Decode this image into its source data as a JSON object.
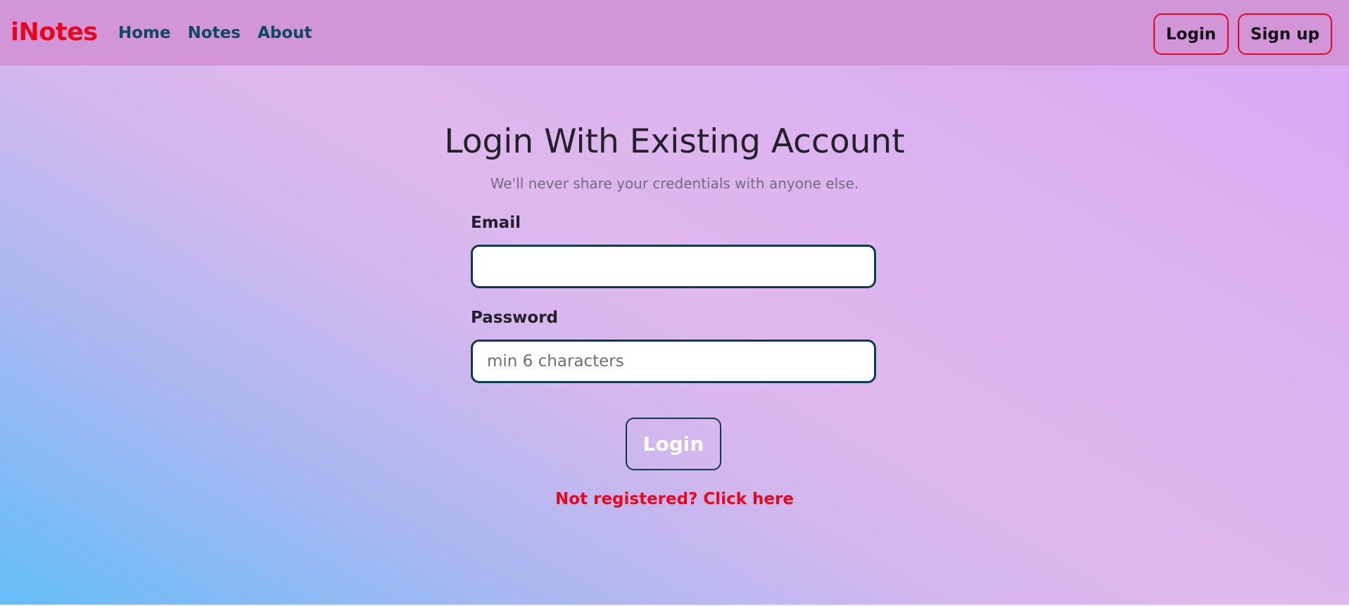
{
  "navbar": {
    "brand": "iNotes",
    "links": [
      {
        "label": "Home"
      },
      {
        "label": "Notes"
      },
      {
        "label": "About"
      }
    ],
    "login_label": "Login",
    "signup_label": "Sign up"
  },
  "form": {
    "title": "Login With Existing Account",
    "subtitle": "We'll never share your credentials with anyone else.",
    "email_label": "Email",
    "email_value": "",
    "email_placeholder": "",
    "password_label": "Password",
    "password_value": "",
    "password_placeholder": "min 6 characters",
    "submit_label": "Login",
    "register_link": "Not registered? Click here"
  },
  "colors": {
    "brand": "#e8081d",
    "nav_link": "#0e4a5e",
    "navbar_bg": "#d195d8",
    "input_border": "#0e3a4a"
  }
}
